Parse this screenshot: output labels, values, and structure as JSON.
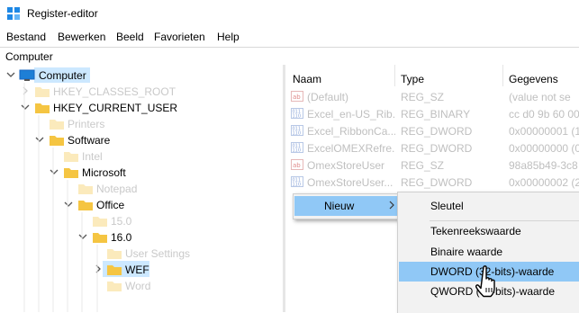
{
  "window": {
    "title": "Register-editor"
  },
  "menubar": {
    "items": [
      "Bestand",
      "Bewerken",
      "Beeld",
      "Favorieten",
      "Help"
    ]
  },
  "address": {
    "path": "Computer"
  },
  "tree": {
    "computer": "Computer",
    "hkcr": "HKEY_CLASSES_ROOT",
    "hkcu": "HKEY_CURRENT_USER",
    "printers": "Printers",
    "software": "Software",
    "intel": "Intel",
    "microsoft": "Microsoft",
    "notepad": "Notepad",
    "office": "Office",
    "v150": "15.0",
    "v160": "16.0",
    "user_settings": "User Settings",
    "wef": "WEF",
    "word": "Word"
  },
  "list": {
    "headers": {
      "name": "Naam",
      "type": "Type",
      "data": "Gegevens"
    },
    "rows": [
      {
        "icon": "string-value-icon",
        "name": "(Default)",
        "type": "REG_SZ",
        "data": "(value not se"
      },
      {
        "icon": "binary-value-icon",
        "name": "Excel_en-US_Rib...",
        "type": "REG_BINARY",
        "data": "cc d0 9b 60 00"
      },
      {
        "icon": "binary-value-icon",
        "name": "Excel_RibbonCa...",
        "type": "REG_DWORD",
        "data": "0x00000001 (1"
      },
      {
        "icon": "binary-value-icon",
        "name": "ExcelOMEXRefre...",
        "type": "REG_DWORD",
        "data": "0x00000000 (0"
      },
      {
        "icon": "string-value-icon",
        "name": "OmexStoreUser",
        "type": "REG_SZ",
        "data": "98a85b49-3c8"
      },
      {
        "icon": "binary-value-icon",
        "name": "OmexStoreUser...",
        "type": "REG_DWORD",
        "data": "0x00000002 (2"
      }
    ]
  },
  "context_menu": {
    "new_label": "Nieuw"
  },
  "submenu": {
    "items": {
      "key": "Sleutel",
      "string": "Tekenreekswaarde",
      "binary": "Binaire waarde",
      "dword": "DWORD (32-bits)-waarde",
      "qword": "QWORD (64-bits)-waarde"
    }
  },
  "colors": {
    "selection": "#cce8ff",
    "menu_highlight": "#90c8f6",
    "menu_bg": "#f2f2f2",
    "folder": "#f5c542",
    "faded_text": "#c9c9c9"
  }
}
